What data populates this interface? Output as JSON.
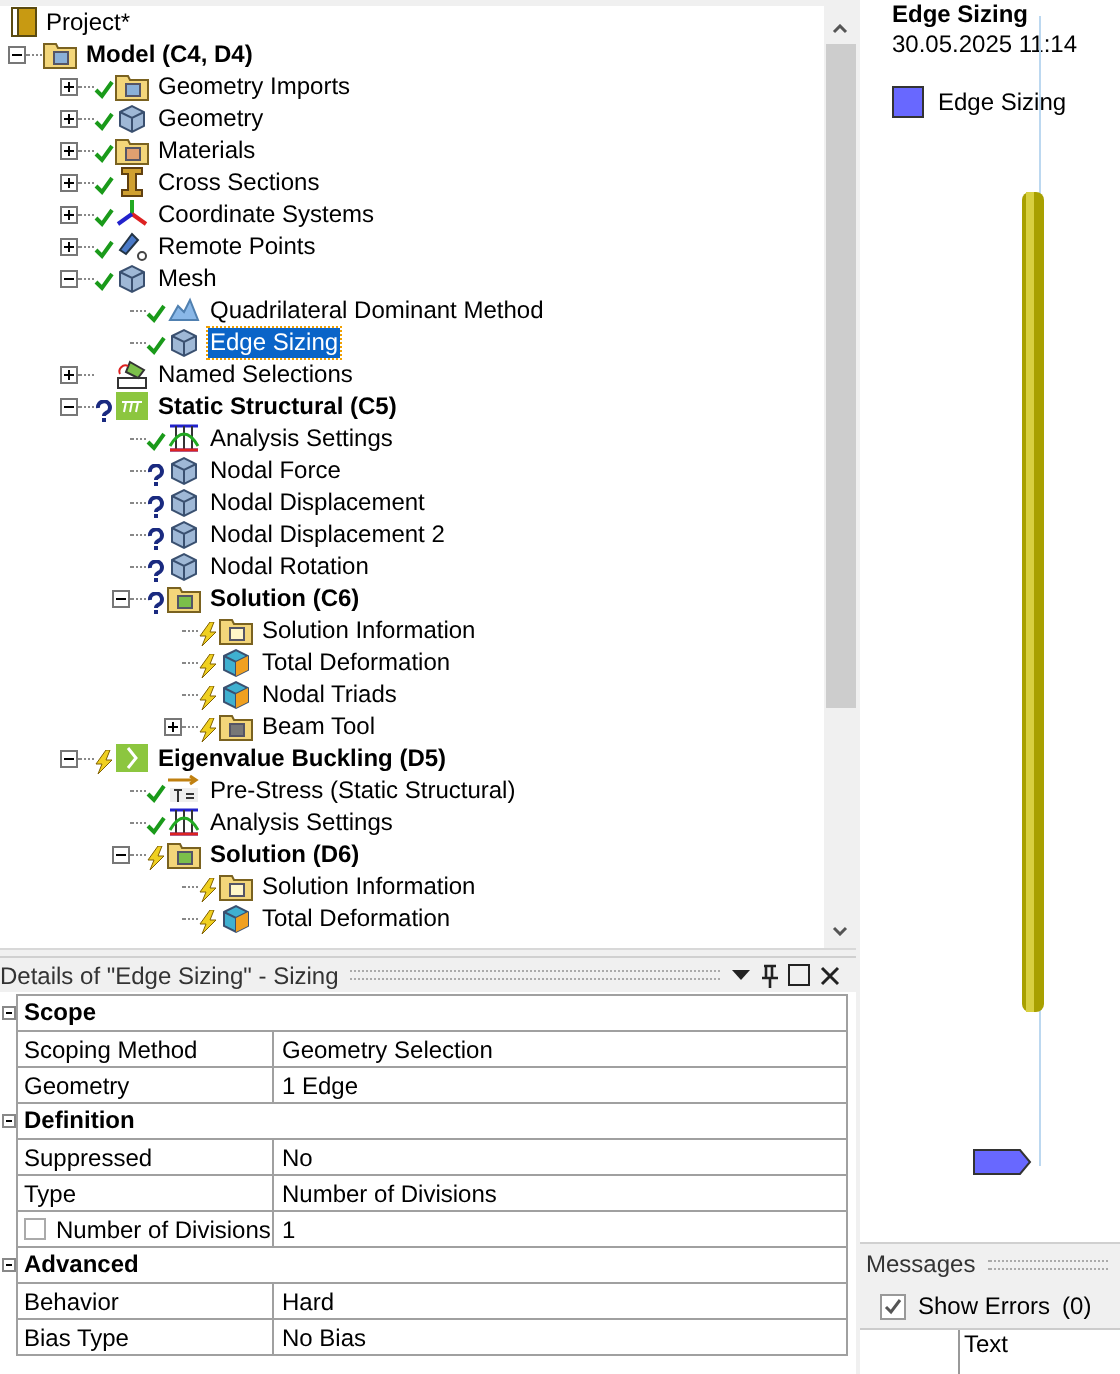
{
  "tree": {
    "label": "Project*",
    "kind": "project",
    "children": [
      {
        "label": "Model (C4, D4)",
        "bold": true,
        "expanded": true,
        "kind": "model",
        "children": [
          {
            "label": "Geometry Imports",
            "expanded": false,
            "status": {
              "kind": "check"
            },
            "kind": "folder-cube"
          },
          {
            "label": "Geometry",
            "expanded": false,
            "status": {
              "kind": "check"
            },
            "kind": "cube"
          },
          {
            "label": "Materials",
            "expanded": false,
            "status": {
              "kind": "check"
            },
            "kind": "folder-tag"
          },
          {
            "label": "Cross Sections",
            "expanded": false,
            "status": {
              "kind": "check"
            },
            "kind": "ibeam"
          },
          {
            "label": "Coordinate Systems",
            "expanded": false,
            "status": {
              "kind": "check"
            },
            "kind": "axes"
          },
          {
            "label": "Remote Points",
            "expanded": false,
            "status": {
              "kind": "check"
            },
            "kind": "remote"
          },
          {
            "label": "Mesh",
            "expanded": true,
            "status": {
              "kind": "check"
            },
            "kind": "cube",
            "children": [
              {
                "label": "Quadrilateral Dominant Method",
                "status": {
                  "kind": "check"
                },
                "kind": "mesh-method"
              },
              {
                "label": "Edge Sizing",
                "status": {
                  "kind": "check"
                },
                "kind": "sizing",
                "selected": true
              }
            ]
          },
          {
            "label": "Named Selections",
            "expanded": false,
            "kind": "named"
          },
          {
            "label": "Static Structural (C5)",
            "bold": true,
            "expanded": true,
            "status": {
              "kind": "question"
            },
            "kind": "static",
            "children": [
              {
                "label": "Analysis Settings",
                "status": {
                  "kind": "check"
                },
                "kind": "settings"
              },
              {
                "label": "Nodal Force",
                "status": {
                  "kind": "question"
                },
                "kind": "probe"
              },
              {
                "label": "Nodal Displacement",
                "status": {
                  "kind": "question"
                },
                "kind": "probe"
              },
              {
                "label": "Nodal Displacement 2",
                "status": {
                  "kind": "question"
                },
                "kind": "probe"
              },
              {
                "label": "Nodal Rotation",
                "status": {
                  "kind": "question"
                },
                "kind": "probe"
              },
              {
                "label": "Solution (C6)",
                "bold": true,
                "expanded": true,
                "status": {
                  "kind": "question"
                },
                "kind": "solution",
                "children": [
                  {
                    "label": "Solution Information",
                    "status": {
                      "kind": "lightning"
                    },
                    "kind": "info"
                  },
                  {
                    "label": "Total Deformation",
                    "status": {
                      "kind": "lightning"
                    },
                    "kind": "result"
                  },
                  {
                    "label": "Nodal Triads",
                    "status": {
                      "kind": "lightning"
                    },
                    "kind": "result"
                  },
                  {
                    "label": "Beam Tool",
                    "expanded": false,
                    "status": {
                      "kind": "lightning"
                    },
                    "kind": "beam-tool"
                  }
                ]
              }
            ]
          },
          {
            "label": "Eigenvalue Buckling (D5)",
            "bold": true,
            "expanded": true,
            "status": {
              "kind": "lightning"
            },
            "kind": "eigen",
            "children": [
              {
                "label": "Pre-Stress (Static Structural)",
                "status": {
                  "kind": "check"
                },
                "kind": "prestress"
              },
              {
                "label": "Analysis Settings",
                "status": {
                  "kind": "check"
                },
                "kind": "settings"
              },
              {
                "label": "Solution (D6)",
                "bold": true,
                "expanded": true,
                "status": {
                  "kind": "lightning"
                },
                "kind": "solution",
                "children": [
                  {
                    "label": "Solution Information",
                    "status": {
                      "kind": "lightning"
                    },
                    "kind": "info"
                  },
                  {
                    "label": "Total Deformation",
                    "status": {
                      "kind": "lightning"
                    },
                    "kind": "result"
                  }
                ]
              }
            ]
          }
        ]
      }
    ]
  },
  "details": {
    "title": "Details of \"Edge Sizing\" - Sizing",
    "groups": [
      {
        "title": "Scope",
        "expanded": true,
        "rows": [
          {
            "label": "Scoping Method",
            "value": "Geometry Selection"
          },
          {
            "label": "Geometry",
            "value": "1 Edge"
          }
        ]
      },
      {
        "title": "Definition",
        "expanded": true,
        "rows": [
          {
            "label": "Suppressed",
            "value": "No"
          },
          {
            "label": "Type",
            "value": "Number of Divisions"
          },
          {
            "label": "Number of Divisions",
            "value": "1",
            "checked": false
          }
        ]
      },
      {
        "title": "Advanced",
        "expanded": true,
        "rows": [
          {
            "label": "Behavior",
            "value": "Hard"
          },
          {
            "label": "Bias Type",
            "value": "No Bias"
          }
        ]
      }
    ]
  },
  "graphics": {
    "title": "Edge Sizing",
    "timestamp": "30.05.2025 11:14",
    "legend": "Edge Sizing"
  },
  "messages": {
    "title": "Messages",
    "show_errors": {
      "label": "Show Errors",
      "count": "(0)",
      "checked": true
    },
    "columns": [
      "Text"
    ]
  }
}
